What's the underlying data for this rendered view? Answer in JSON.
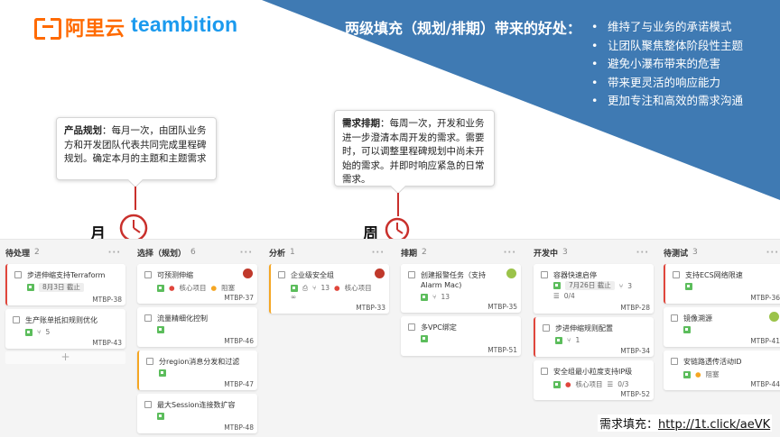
{
  "branding": {
    "aliyun": "阿里云",
    "teambition": "teambition"
  },
  "heading": "两级填充（规划/排期）带来的好处：",
  "benefits": [
    "维持了与业务的承诺模式",
    "让团队聚焦整体阶段性主题",
    "避免小瀑布带来的危害",
    "带来更灵活的响应能力",
    "更加专注和高效的需求沟通"
  ],
  "colors": {
    "banner": "#3f7ab3",
    "accent_red": "#c9302c",
    "ali_orange": "#ff6a00",
    "tb_blue": "#1b9aee"
  },
  "callout_month": {
    "title": "产品规划",
    "text": "：每月一次，由团队业务方和开发团队代表共同完成里程碑规划。确定本月的主题和主题需求"
  },
  "callout_week": {
    "title": "需求排期",
    "text": "：每周一次，开发和业务进一步澄清本周开发的需求。需要时，可以调整里程碑规划中尚未开始的需求。并即时响应紧急的日常需求。"
  },
  "labels": {
    "month": "月",
    "week": "周"
  },
  "board": {
    "columns": [
      {
        "title": "待处理",
        "count": "2",
        "cards": [
          {
            "title": "步进伸缩支持Terraform",
            "date": "8月3日 截止",
            "id": "MTBP-38"
          },
          {
            "title": "生产账单抵扣规则优化",
            "sub": "5",
            "id": "MTBP-43"
          }
        ]
      },
      {
        "title": "选择（规划）",
        "count": "6",
        "cards": [
          {
            "title": "可预测伸缩",
            "tag1": "核心项目",
            "tag2": "阻塞",
            "id": "MTBP-37"
          },
          {
            "title": "流量精细化控制",
            "id": "MTBP-46"
          },
          {
            "title": "分region消息分发和过滤",
            "id": "MTBP-47"
          },
          {
            "title": "最大Session连接数扩容",
            "id": "MTBP-48"
          }
        ]
      },
      {
        "title": "分析",
        "count": "1",
        "cards": [
          {
            "title": "企业级安全组",
            "sub": "13",
            "tag1": "核心项目",
            "id": "MTBP-33"
          }
        ]
      },
      {
        "title": "排期",
        "count": "2",
        "cards": [
          {
            "title": "创建报警任务（支持Alarm Mac)",
            "sub": "13",
            "id": "MTBP-35"
          },
          {
            "title": "多VPC绑定",
            "id": "MTBP-51"
          }
        ]
      },
      {
        "title": "开发中",
        "count": "3",
        "cards": [
          {
            "title": "容器快速启停",
            "date": "7月26日 截止",
            "sub": "3",
            "check": "0/4",
            "id": "MTBP-28"
          },
          {
            "title": "步进伸缩规则配置",
            "sub": "1",
            "id": "MTBP-34"
          },
          {
            "title": "安全组最小粒度支持IP级",
            "tag1": "核心项目",
            "check": "0/3",
            "id": "MTBP-52"
          }
        ]
      },
      {
        "title": "待测试",
        "count": "3",
        "cards": [
          {
            "title": "支持ECS网络限速",
            "id": "MTBP-36"
          },
          {
            "title": "镜像溯源",
            "id": "MTBP-41"
          },
          {
            "title": "安链路透传活动ID",
            "tag2": "阻塞",
            "id": "MTBP-44"
          }
        ]
      }
    ],
    "more": "···",
    "add": "+"
  },
  "footer": {
    "label": "需求填充：",
    "url": "http://1t.click/aeVK"
  }
}
